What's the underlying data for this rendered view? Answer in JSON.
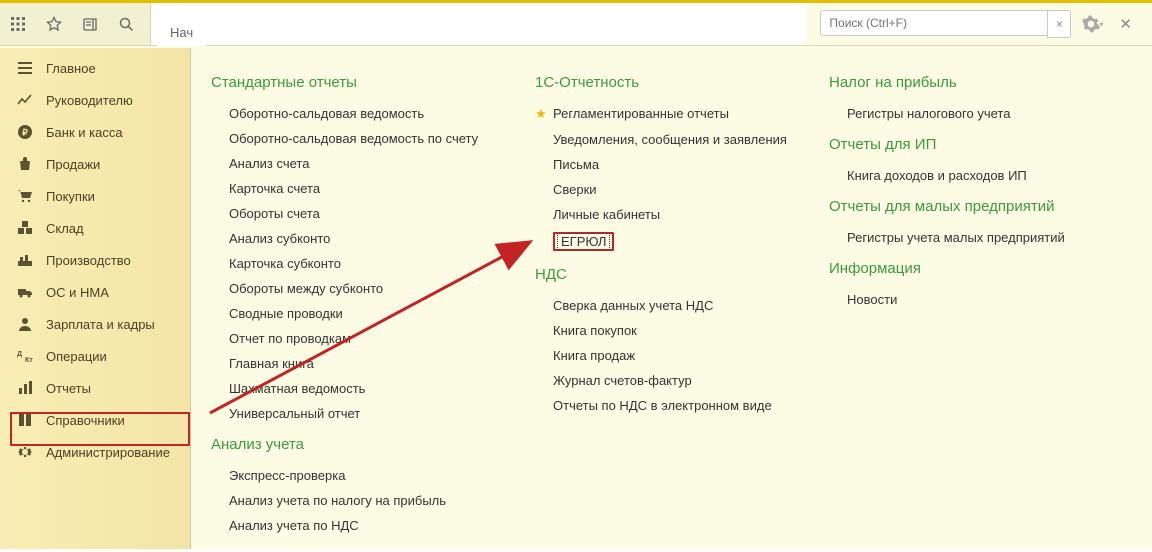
{
  "topbar": {
    "tab_label": "Нач",
    "search_placeholder": "Поиск (Ctrl+F)"
  },
  "sidebar": {
    "items": [
      {
        "label": "Главное"
      },
      {
        "label": "Руководителю"
      },
      {
        "label": "Банк и касса"
      },
      {
        "label": "Продажи"
      },
      {
        "label": "Покупки"
      },
      {
        "label": "Склад"
      },
      {
        "label": "Производство"
      },
      {
        "label": "ОС и НМА"
      },
      {
        "label": "Зарплата и кадры"
      },
      {
        "label": "Операции"
      },
      {
        "label": "Отчеты"
      },
      {
        "label": "Справочники"
      },
      {
        "label": "Администрирование"
      }
    ]
  },
  "content": {
    "col1": {
      "s1_title": "Стандартные отчеты",
      "s1_items": {
        "0": "Оборотно-сальдовая ведомость",
        "1": "Оборотно-сальдовая ведомость по счету",
        "2": "Анализ счета",
        "3": "Карточка счета",
        "4": "Обороты счета",
        "5": "Анализ субконто",
        "6": "Карточка субконто",
        "7": "Обороты между субконто",
        "8": "Сводные проводки",
        "9": "Отчет по проводкам",
        "10": "Главная книга",
        "11": "Шахматная ведомость",
        "12": "Универсальный отчет"
      },
      "s2_title": "Анализ учета",
      "s2_items": {
        "0": "Экспресс-проверка",
        "1": "Анализ учета по налогу на прибыль",
        "2": "Анализ учета по НДС"
      }
    },
    "col2": {
      "s1_title": "1С-Отчетность",
      "s1_items": {
        "0": "Регламентированные отчеты",
        "1": "Уведомления, сообщения и заявления",
        "2": "Письма",
        "3": "Сверки",
        "4": "Личные кабинеты",
        "5": "ЕГРЮЛ"
      },
      "s2_title": "НДС",
      "s2_items": {
        "0": "Сверка данных учета НДС",
        "1": "Книга покупок",
        "2": "Книга продаж",
        "3": "Журнал счетов-фактур",
        "4": "Отчеты по НДС в электронном виде"
      }
    },
    "col3": {
      "s1_title": "Налог на прибыль",
      "s1_items": {
        "0": "Регистры налогового учета"
      },
      "s2_title": "Отчеты для ИП",
      "s2_items": {
        "0": "Книга доходов и расходов ИП"
      },
      "s3_title": "Отчеты для малых предприятий",
      "s3_items": {
        "0": "Регистры учета малых предприятий"
      },
      "s4_title": "Информация",
      "s4_items": {
        "0": "Новости"
      }
    }
  }
}
